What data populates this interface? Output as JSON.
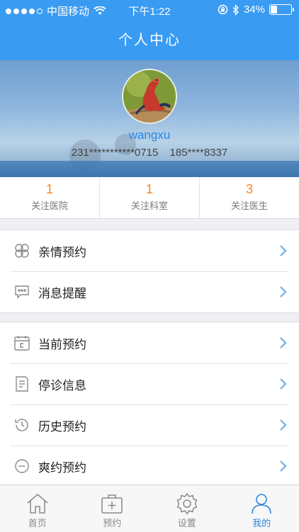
{
  "status_bar": {
    "carrier": "中国移动",
    "time": "下午1:22",
    "battery_percent": "34%",
    "battery_level": 0.34
  },
  "header": {
    "title": "个人中心"
  },
  "profile": {
    "username": "wangxu",
    "id_number": "231***********0715",
    "phone": "185****8337"
  },
  "stats": [
    {
      "count": "1",
      "label": "关注医院"
    },
    {
      "count": "1",
      "label": "关注科室"
    },
    {
      "count": "3",
      "label": "关注医生"
    }
  ],
  "menu_group_1": [
    {
      "label": "亲情预约",
      "icon": "family-icon"
    },
    {
      "label": "消息提醒",
      "icon": "message-icon"
    }
  ],
  "menu_group_2": [
    {
      "label": "当前预约",
      "icon": "calendar-icon"
    },
    {
      "label": "停诊信息",
      "icon": "document-icon"
    },
    {
      "label": "历史预约",
      "icon": "history-icon"
    },
    {
      "label": "爽约预约",
      "icon": "minus-circle-icon"
    }
  ],
  "tabs": [
    {
      "label": "首页",
      "icon": "home-icon"
    },
    {
      "label": "预约",
      "icon": "medical-kit-icon"
    },
    {
      "label": "设置",
      "icon": "gear-icon"
    },
    {
      "label": "我的",
      "icon": "user-icon",
      "active": true
    }
  ],
  "colors": {
    "primary": "#3a9bf2",
    "accent_orange": "#f5891f",
    "link_blue": "#2d86e0"
  }
}
